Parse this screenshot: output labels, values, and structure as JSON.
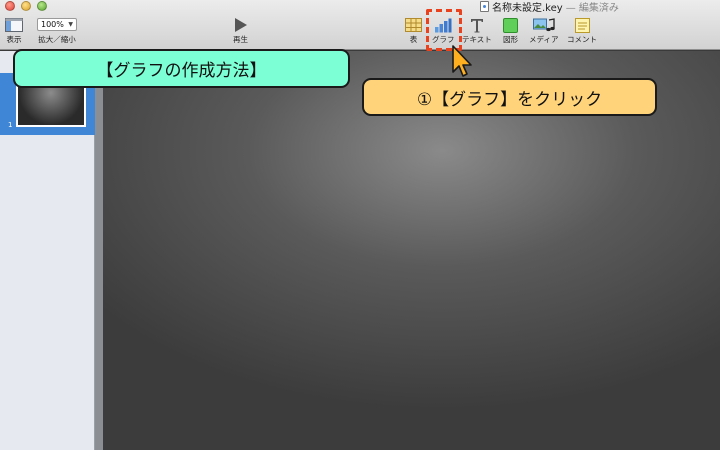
{
  "window": {
    "title": "名称未設定.key",
    "status": "— 編集済み"
  },
  "toolbar": {
    "view_label": "表示",
    "zoom_value": "100%",
    "zoom_label": "拡大／縮小",
    "play_label": "再生",
    "table_label": "表",
    "chart_label": "グラフ",
    "text_label": "テキスト",
    "shape_label": "図形",
    "media_label": "メディア",
    "comment_label": "コメント"
  },
  "navigator": {
    "slides": [
      {
        "number": "1"
      }
    ]
  },
  "annotations": {
    "title_callout": "【グラフの作成方法】",
    "step_callout": "①【グラフ】をクリック"
  },
  "colors": {
    "title_callout_bg": "#7dffd6",
    "step_callout_bg": "#ffd37a",
    "highlight": "#e8421e",
    "selection": "#3f86d7"
  },
  "icons": {
    "view": "sidebar-view-icon",
    "play": "play-icon",
    "table": "table-icon",
    "chart": "bar-chart-icon",
    "text": "text-icon",
    "shape": "shape-icon",
    "media": "media-icon",
    "comment": "comment-icon",
    "cursor": "mouse-pointer-icon"
  }
}
